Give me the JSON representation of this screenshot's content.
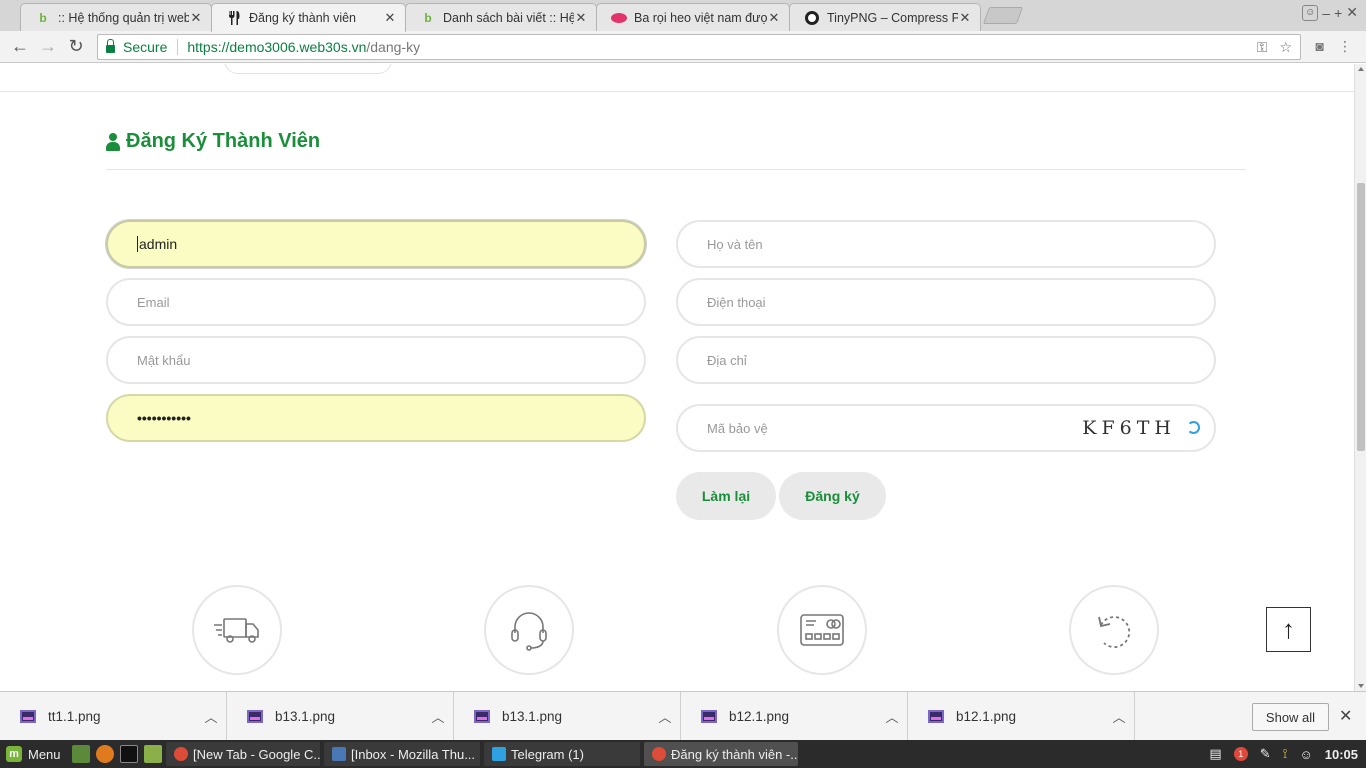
{
  "browser": {
    "tabs": [
      {
        "title": ":: Hệ thống quản trị website",
        "favicon": "b-icon"
      },
      {
        "title": "Đăng ký thành viên",
        "favicon": "fork-knife-icon",
        "active": true
      },
      {
        "title": "Danh sách bài viết :: Hệ thống",
        "favicon": "b-icon"
      },
      {
        "title": "Ba rọi heo việt nam được",
        "favicon": "lips-icon"
      },
      {
        "title": "TinyPNG – Compress PNG",
        "favicon": "panda-icon"
      }
    ],
    "secure_label": "Secure",
    "url_scheme_host": "https://demo3006.web30s.vn",
    "url_path": "/dang-ky"
  },
  "page": {
    "title": "Đăng Ký Thành Viên",
    "form": {
      "username_value": "admin",
      "email_placeholder": "Email",
      "password_placeholder": "Mật khẩu",
      "confirm_password_value": "•••••••••••",
      "fullname_placeholder": "Họ và tên",
      "phone_placeholder": "Điện thoại",
      "address_placeholder": "Địa chỉ",
      "captcha_placeholder": "Mã bảo vệ",
      "captcha_code": "KF6TH",
      "reset_label": "Làm lại",
      "submit_label": "Đăng ký"
    },
    "features": [
      {
        "icon": "delivery-truck-icon"
      },
      {
        "icon": "headset-support-icon"
      },
      {
        "icon": "credit-card-icon"
      },
      {
        "icon": "return-arrow-icon"
      }
    ],
    "back_to_top_symbol": "↑"
  },
  "downloads": {
    "items": [
      {
        "name": "tt1.1.png"
      },
      {
        "name": "b13.1.png"
      },
      {
        "name": "b13.1.png"
      },
      {
        "name": "b12.1.png"
      },
      {
        "name": "b12.1.png"
      }
    ],
    "show_all_label": "Show all"
  },
  "taskbar": {
    "menu_label": "Menu",
    "tasks": [
      {
        "label": "[New Tab - Google C..."
      },
      {
        "label": "[Inbox - Mozilla Thu..."
      },
      {
        "label": "Telegram (1)"
      },
      {
        "label": "Đăng ký thành viên -..."
      }
    ],
    "notification_count": "1",
    "clock": "10:05"
  },
  "colors": {
    "brand_green": "#1b8e3c",
    "autofill_yellow": "#fafcc3",
    "secure_green": "#0b8043",
    "captcha_refresh_blue": "#2ea1e0"
  }
}
